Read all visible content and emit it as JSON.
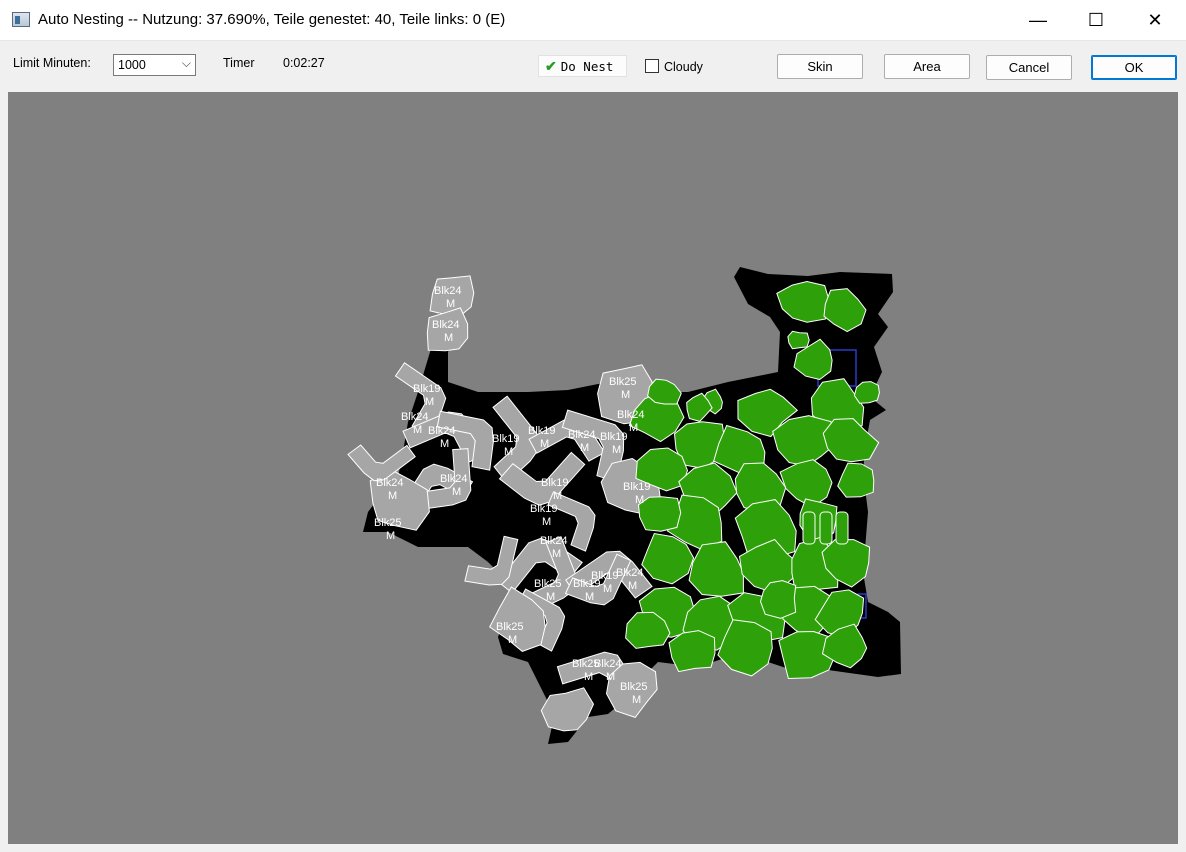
{
  "window": {
    "title": "Auto Nesting --  Nutzung: 37.690%, Teile genestet: 40, Teile links: 0   (E)",
    "minimize_glyph": "—",
    "maximize_glyph": "☐",
    "close_glyph": "✕"
  },
  "toolbar": {
    "limit_label": "Limit Minuten:",
    "limit_value": "1000",
    "timer_label": "Timer",
    "timer_value": "0:02:27",
    "donest_label": "Do Nest",
    "donest_checked": true,
    "cloudy_label": "Cloudy",
    "cloudy_checked": false,
    "skin_label": "Skin",
    "area_label": "Area",
    "cancel_label": "Cancel",
    "ok_label": "OK"
  },
  "nesting": {
    "colors": {
      "background": "#808080",
      "material": "#000000",
      "placed_piece": "#a6a6a6",
      "nested_piece": "#2ea10a",
      "piece_outline": "#ffffff"
    },
    "grey_labels": [
      {
        "name": "Blk24",
        "qty": "M"
      },
      {
        "name": "Blk24",
        "qty": "M"
      },
      {
        "name": "Blk19",
        "qty": "M"
      },
      {
        "name": "Blk24",
        "qty": "M"
      },
      {
        "name": "Blk24",
        "qty": "M"
      },
      {
        "name": "Blk19",
        "qty": "M"
      },
      {
        "name": "Blk19",
        "qty": "M"
      },
      {
        "name": "Blk24",
        "qty": "M"
      },
      {
        "name": "Blk19",
        "qty": "M"
      },
      {
        "name": "Blk24",
        "qty": "M"
      },
      {
        "name": "Blk24",
        "qty": "M"
      },
      {
        "name": "Blk19",
        "qty": "M"
      },
      {
        "name": "Blk19",
        "qty": "M"
      },
      {
        "name": "Blk24",
        "qty": "M"
      },
      {
        "name": "Blk19",
        "qty": "M"
      },
      {
        "name": "Blk25",
        "qty": "M"
      },
      {
        "name": "Blk19",
        "qty": "M"
      },
      {
        "name": "Blk24",
        "qty": "M"
      },
      {
        "name": "Blk25",
        "qty": "M"
      },
      {
        "name": "Blk24",
        "qty": "M"
      },
      {
        "name": "Blk19",
        "qty": "M"
      },
      {
        "name": "Blk25",
        "qty": "M"
      },
      {
        "name": "Blk25",
        "qty": "M"
      },
      {
        "name": "Blk25",
        "qty": "M"
      },
      {
        "name": "Blk25",
        "qty": "M"
      },
      {
        "name": "Blk24",
        "qty": "M"
      }
    ]
  }
}
